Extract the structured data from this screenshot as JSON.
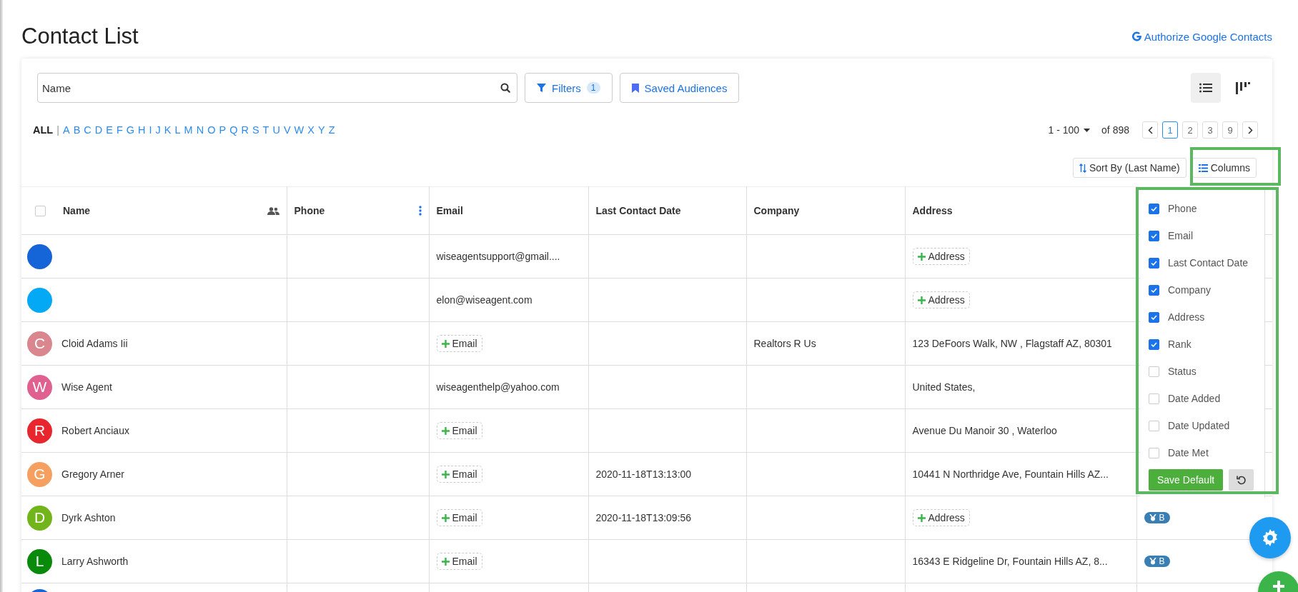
{
  "page": {
    "title": "Contact List",
    "google_link": "Authorize Google Contacts"
  },
  "search": {
    "placeholder": "Name"
  },
  "filters": {
    "label": "Filters",
    "count": "1"
  },
  "saved_audiences": {
    "label": "Saved Audiences"
  },
  "view_toggle": [
    {
      "kind": "list",
      "selected": true
    },
    {
      "kind": "board",
      "selected": false
    }
  ],
  "alphabet": {
    "separator": "|",
    "items": [
      {
        "label": "ALL",
        "selected": true
      },
      {
        "label": "A",
        "selected": false
      },
      {
        "label": "B",
        "selected": false
      },
      {
        "label": "C",
        "selected": false
      },
      {
        "label": "D",
        "selected": false
      },
      {
        "label": "E",
        "selected": false
      },
      {
        "label": "F",
        "selected": false
      },
      {
        "label": "G",
        "selected": false
      },
      {
        "label": "H",
        "selected": false
      },
      {
        "label": "I",
        "selected": false
      },
      {
        "label": "J",
        "selected": false
      },
      {
        "label": "K",
        "selected": false
      },
      {
        "label": "L",
        "selected": false
      },
      {
        "label": "M",
        "selected": false
      },
      {
        "label": "N",
        "selected": false
      },
      {
        "label": "O",
        "selected": false
      },
      {
        "label": "P",
        "selected": false
      },
      {
        "label": "Q",
        "selected": false
      },
      {
        "label": "R",
        "selected": false
      },
      {
        "label": "S",
        "selected": false
      },
      {
        "label": "T",
        "selected": false
      },
      {
        "label": "U",
        "selected": false
      },
      {
        "label": "V",
        "selected": false
      },
      {
        "label": "W",
        "selected": false
      },
      {
        "label": "X",
        "selected": false
      },
      {
        "label": "Y",
        "selected": false
      },
      {
        "label": "Z",
        "selected": false
      }
    ]
  },
  "pagination": {
    "range": "1 - 100",
    "total": "of 898",
    "pages": [
      {
        "label": "1",
        "selected": true
      },
      {
        "label": "2",
        "selected": false
      },
      {
        "label": "3",
        "selected": false
      },
      {
        "label": "9",
        "selected": false
      }
    ]
  },
  "sort_button": {
    "label": "Sort By (Last Name)"
  },
  "columns_button": {
    "label": "Columns"
  },
  "table": {
    "select_all": {
      "checked": false
    },
    "columns": [
      {
        "label": "Name",
        "kind": "name"
      },
      {
        "label": "Phone",
        "kind": "phone"
      },
      {
        "label": "Email",
        "kind": "plain"
      },
      {
        "label": "Last Contact Date",
        "kind": "plain"
      },
      {
        "label": "Company",
        "kind": "plain"
      },
      {
        "label": "Address",
        "kind": "plain"
      },
      {
        "kind": "rank"
      }
    ],
    "rows": [
      {
        "avatar": {
          "color": "#1565d8"
        },
        "name": "",
        "phone": "",
        "email": {
          "kind": "text",
          "label": "wiseagentsupport@gmail...."
        },
        "last_contact": "",
        "company": "",
        "address": {
          "kind": "add",
          "label": "Address"
        }
      },
      {
        "avatar": {
          "color": "#03a9f4"
        },
        "name": "",
        "phone": "",
        "email": {
          "kind": "text",
          "label": "elon@wiseagent.com"
        },
        "last_contact": "",
        "company": "",
        "address": {
          "kind": "add",
          "label": "Address"
        }
      },
      {
        "avatar": {
          "initial": "C",
          "color": "#d9868e"
        },
        "name": "Cloid Adams Iii",
        "phone": "",
        "email": {
          "kind": "add",
          "label": "Email"
        },
        "last_contact": "",
        "company": "Realtors R Us",
        "address": {
          "kind": "text",
          "label": "123 DeFoors Walk, NW , Flagstaff AZ, 80301"
        }
      },
      {
        "avatar": {
          "initial": "W",
          "color": "#e0608f"
        },
        "name": "Wise Agent",
        "phone": "",
        "email": {
          "kind": "text",
          "label": "wiseagenthelp@yahoo.com"
        },
        "last_contact": "",
        "company": "",
        "address": {
          "kind": "text",
          "label": "United States,"
        }
      },
      {
        "avatar": {
          "initial": "R",
          "color": "#e8262e"
        },
        "name": "Robert Anciaux",
        "phone": "",
        "email": {
          "kind": "add",
          "label": "Email"
        },
        "last_contact": "",
        "company": "",
        "address": {
          "kind": "text",
          "label": "Avenue Du Manoir 30 , Waterloo"
        }
      },
      {
        "avatar": {
          "initial": "G",
          "color": "#f5a061"
        },
        "name": "Gregory Arner",
        "phone": "",
        "email": {
          "kind": "add",
          "label": "Email"
        },
        "last_contact": "2020-11-18T13:13:00",
        "company": "",
        "address": {
          "kind": "text",
          "label": "10441 N Northridge Ave, Fountain Hills AZ..."
        }
      },
      {
        "avatar": {
          "initial": "D",
          "color": "#72b51b"
        },
        "name": "Dyrk Ashton",
        "phone": "",
        "email": {
          "kind": "add",
          "label": "Email"
        },
        "last_contact": "2020-11-18T13:09:56",
        "company": "",
        "address": {
          "kind": "add",
          "label": "Address"
        },
        "rank": "B"
      },
      {
        "avatar": {
          "initial": "L",
          "color": "#0a8a0a"
        },
        "name": "Larry Ashworth",
        "phone": "",
        "email": {
          "kind": "add",
          "label": "Email"
        },
        "last_contact": "",
        "company": "",
        "address": {
          "kind": "text",
          "label": "16343 E Ridgeline Dr, Fountain Hills AZ, 8..."
        },
        "rank": "B"
      },
      {
        "avatar": {
          "color": "#1565d8"
        }
      }
    ]
  },
  "columns_menu": {
    "items": [
      {
        "label": "Phone",
        "checked": true
      },
      {
        "label": "Email",
        "checked": true
      },
      {
        "label": "Last Contact Date",
        "checked": true
      },
      {
        "label": "Company",
        "checked": true
      },
      {
        "label": "Address",
        "checked": true
      },
      {
        "label": "Rank",
        "checked": true
      },
      {
        "label": "Status",
        "checked": false
      },
      {
        "label": "Date Added",
        "checked": false
      },
      {
        "label": "Date Updated",
        "checked": false
      },
      {
        "label": "Date Met",
        "checked": false
      }
    ],
    "save_button": "Save Default"
  }
}
